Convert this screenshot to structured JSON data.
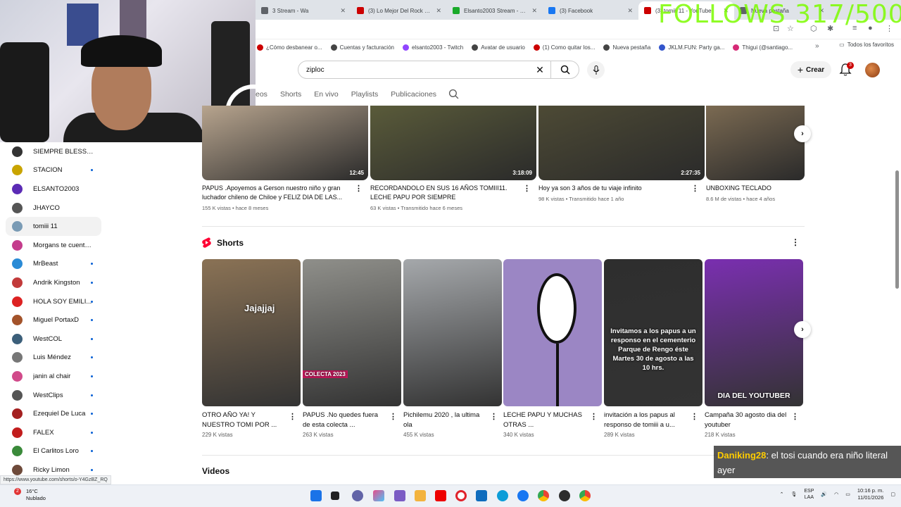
{
  "browser": {
    "tabs": [
      {
        "label": "3 Stream - Wa",
        "color": "#5f6368"
      },
      {
        "label": "(3) Lo Mejor Del Rock En E",
        "color": "#cc0000"
      },
      {
        "label": "Elsanto2003 Stream - Wa",
        "color": "#1aaa2a"
      },
      {
        "label": "(3) Facebook",
        "color": "#1877f2"
      },
      {
        "label": "(3) tomiii 11 - YouTube",
        "color": "#cc0000"
      },
      {
        "label": "Nueva pestaña",
        "color": "#5f6368"
      }
    ],
    "bookmarks": [
      {
        "label": "¿Cómo desbanear o...",
        "color": "#cc0000"
      },
      {
        "label": "Cuentas y facturación",
        "color": "#444"
      },
      {
        "label": "elsanto2003 - Twitch",
        "color": "#9146ff"
      },
      {
        "label": "Avatar de usuario",
        "color": "#444"
      },
      {
        "label": "(1) Como quitar los...",
        "color": "#cc0000"
      },
      {
        "label": "Nueva pestaña",
        "color": "#444"
      },
      {
        "label": "JKLM.FUN: Party ga...",
        "color": "#3355cc"
      },
      {
        "label": "Thigui (@santiago...",
        "color": "#d62976"
      }
    ],
    "favorites_label": "Todos los favoritos",
    "status_url": "https://www.youtube.com/shorts/o-Y4GzBZ_RQ"
  },
  "overlay": {
    "follows": "FOLLOWS 317/500",
    "chat_user": "Daniking28",
    "chat_message": ": el tosi cuando era niño literal ayer"
  },
  "sidebar": {
    "subscriptions": [
      {
        "name": "SIEMPRE BLESSD ...",
        "color": "#333",
        "dot": false
      },
      {
        "name": "STACION",
        "color": "#c9a400",
        "dot": true
      },
      {
        "name": "ELSANTO2003",
        "color": "#5b2bb5",
        "dot": false
      },
      {
        "name": "JHAYCO",
        "color": "#555",
        "dot": false
      },
      {
        "name": "tomiii 11",
        "color": "#7a9bb5",
        "dot": false,
        "selected": true
      },
      {
        "name": "Morgans te cuenta ...",
        "color": "#c43c8c",
        "dot": false
      },
      {
        "name": "MrBeast",
        "color": "#2a8bd6",
        "dot": true
      },
      {
        "name": "Andrik Kingston",
        "color": "#c23a3a",
        "dot": true
      },
      {
        "name": "HOLA SOY EMILI...",
        "color": "#d22",
        "dot": true
      },
      {
        "name": "Miguel PortaxD",
        "color": "#a3532a",
        "dot": true
      },
      {
        "name": "WestCOL",
        "color": "#3c5f7a",
        "dot": true
      },
      {
        "name": "Luis Méndez",
        "color": "#777",
        "dot": true
      },
      {
        "name": "janin al chair",
        "color": "#d14a8a",
        "dot": true
      },
      {
        "name": "WestClips",
        "color": "#555",
        "dot": true
      },
      {
        "name": "Ezequiel De Luca",
        "color": "#a42020",
        "dot": true
      },
      {
        "name": "FALEX",
        "color": "#c21d1d",
        "dot": true
      },
      {
        "name": "El Carlitos Loro",
        "color": "#3a8a3a",
        "dot": true
      },
      {
        "name": "Ricky Limon",
        "color": "#6e4a3a",
        "dot": true
      }
    ]
  },
  "header": {
    "search_value": "ziploc",
    "create_label": "Crear",
    "notifications": "3"
  },
  "channel_tabs": [
    "eos",
    "Shorts",
    "En vivo",
    "Playlists",
    "Publicaciones"
  ],
  "videos": [
    {
      "title": "PAPUS .Apoyemos a Gerson nuestro niño y gran luchador chileno de Chiloe y FELIZ DIA DE LAS...",
      "duration": "12:45",
      "meta": "155 K vistas • hace 8 meses",
      "thumb": "#b7a48e"
    },
    {
      "title": "RECORDANDOLO EN SUS 16 AÑOS TOMIII11. LECHE PAPU POR SIEMPRE",
      "duration": "3:18:09",
      "meta": "63 K vistas • Transmitido hace 6 meses",
      "thumb": "#5a5b3a"
    },
    {
      "title": "Hoy ya son 3 años de tu viaje infinito",
      "duration": "2:27:35",
      "meta": "98 K vistas • Transmitido hace 1 año",
      "thumb": "#4d4a35"
    },
    {
      "title": "UNBOXING TECLADO",
      "duration": "",
      "meta": "8.6 M de vistas • hace 4 años",
      "thumb": "#7b6a52"
    }
  ],
  "shorts_section": {
    "title": "Shorts"
  },
  "shorts": [
    {
      "title": "OTRO AÑO YA! Y NUESTRO TOMI POR ...",
      "meta": "229 K vistas",
      "thumb": "#8a7255",
      "overlay": "Jajajjaj"
    },
    {
      "title": "PAPUS .No quedes fuera de esta colecta ...",
      "meta": "263 K vistas",
      "thumb": "#8f8f8a",
      "overlay": "COLECTA 2023"
    },
    {
      "title": "Pichilemu 2020 , la ultima ola",
      "meta": "455 K vistas",
      "thumb": "#a5a8ab",
      "overlay": ""
    },
    {
      "title": "LECHE PAPU Y MUCHAS OTRAS ...",
      "meta": "340 K vistas",
      "thumb": "#9b86c4",
      "overlay": ""
    },
    {
      "title": "invitación a los papus al responso de tomiii a u...",
      "meta": "289 K vistas",
      "thumb": "#2e2e2e",
      "overlay": "Invitamos a los papus a un responso en el cementerio Parque de Rengo éste Martes 30 de agosto a las 10 hrs."
    },
    {
      "title": "Campaña 30 agosto dia del youtuber",
      "meta": "218 K vistas",
      "thumb": "#7a2fb0",
      "overlay": "DIA DEL YOUTUBER"
    }
  ],
  "videos_section": {
    "title": "Videos"
  },
  "taskbar": {
    "temperature": "16°C",
    "weather": "Nublado",
    "weather_badge": "2",
    "lang1": "ESP",
    "lang2": "LAA",
    "time": "10:16 p. m.",
    "date": "11/01/2026"
  }
}
